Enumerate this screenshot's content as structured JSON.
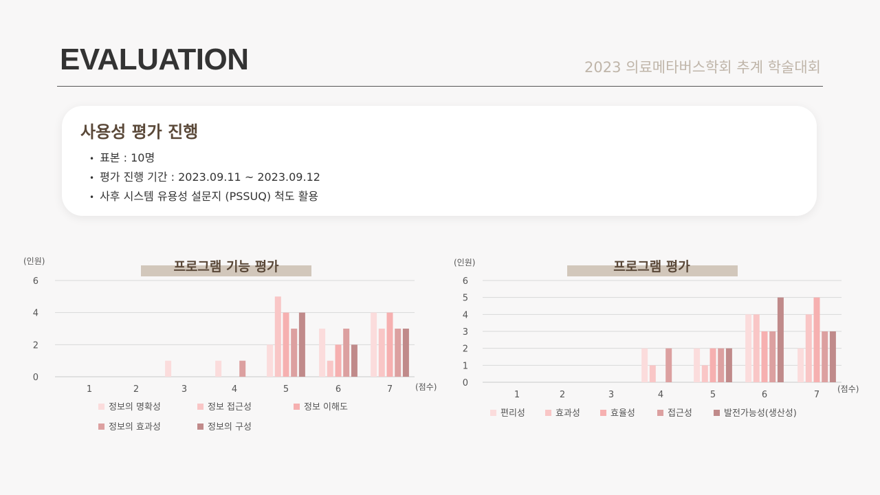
{
  "header": {
    "title": "EVALUATION",
    "subtitle": "2023 의료메타버스학회 추계 학술대회"
  },
  "card": {
    "title": "사용성 평가 진행",
    "items": [
      "표본 : 10명",
      "평가 진행 기간 : 2023.09.11 ~ 2023.09.12",
      "사후 시스템 유용성 설문지 (PSSUQ) 척도 활용"
    ]
  },
  "chart_data": [
    {
      "type": "bar",
      "title": "프로그램 기능 평가",
      "ylabel": "(인원)",
      "xlabel": "(점수)",
      "categories": [
        "1",
        "2",
        "3",
        "4",
        "5",
        "6",
        "7"
      ],
      "yticks": [
        0,
        2,
        4,
        6
      ],
      "ylim": [
        0,
        6
      ],
      "grid": true,
      "legend_position": "bottom",
      "series": [
        {
          "name": "정보의 명확성",
          "color": "#fbdcdc",
          "values": [
            0,
            0,
            1,
            1,
            2,
            3,
            4
          ]
        },
        {
          "name": "정보 접근성",
          "color": "#f9c6c6",
          "values": [
            0,
            0,
            0,
            0,
            5,
            1,
            3
          ]
        },
        {
          "name": "정보 이해도",
          "color": "#f6b0b0",
          "values": [
            0,
            0,
            0,
            0,
            4,
            2,
            4
          ]
        },
        {
          "name": "정보의 효과성",
          "color": "#dca0a0",
          "values": [
            0,
            0,
            0,
            1,
            3,
            3,
            3
          ]
        },
        {
          "name": "정보의 구성",
          "color": "#c08a8a",
          "values": [
            0,
            0,
            0,
            0,
            4,
            2,
            3
          ]
        }
      ]
    },
    {
      "type": "bar",
      "title": "프로그램 평가",
      "ylabel": "(인원)",
      "xlabel": "(점수)",
      "categories": [
        "1",
        "2",
        "3",
        "4",
        "5",
        "6",
        "7"
      ],
      "yticks": [
        0,
        1,
        2,
        3,
        4,
        5,
        6
      ],
      "ylim": [
        0,
        6
      ],
      "grid": true,
      "legend_position": "bottom",
      "series": [
        {
          "name": "편리성",
          "color": "#fbdcdc",
          "values": [
            0,
            0,
            0,
            2,
            2,
            4,
            2
          ]
        },
        {
          "name": "효과성",
          "color": "#f9c6c6",
          "values": [
            0,
            0,
            0,
            1,
            1,
            4,
            4
          ]
        },
        {
          "name": "효율성",
          "color": "#f6b0b0",
          "values": [
            0,
            0,
            0,
            0,
            2,
            3,
            5
          ]
        },
        {
          "name": "접근성",
          "color": "#dca0a0",
          "values": [
            0,
            0,
            0,
            2,
            2,
            3,
            3
          ]
        },
        {
          "name": "발전가능성(생산성)",
          "color": "#c08a8a",
          "values": [
            0,
            0,
            0,
            0,
            2,
            5,
            3
          ]
        }
      ]
    }
  ]
}
